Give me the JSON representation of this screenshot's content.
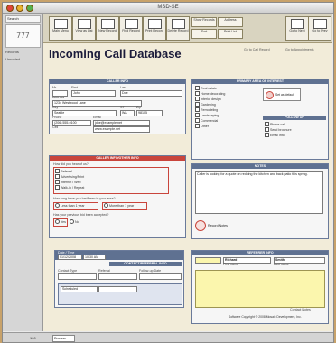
{
  "window": {
    "title": "MSD-SE",
    "light_colors": [
      "#e0443a",
      "#e8b230",
      "#55b14e"
    ]
  },
  "sidebar": {
    "search_label": "Search",
    "book_glyph": "777",
    "records_label": "Records",
    "unsorted_label": "Unsorted"
  },
  "toolbar": {
    "buttons": [
      {
        "label": "Main Menu",
        "icon": "home-icon"
      },
      {
        "label": "View as List",
        "icon": "list-view-icon"
      },
      {
        "label": "New Record",
        "icon": "new-record-icon"
      },
      {
        "label": "Find Record",
        "icon": "find-icon"
      },
      {
        "label": "Print Record",
        "icon": "print-icon"
      },
      {
        "label": "Delete Record",
        "icon": "delete-icon"
      }
    ],
    "small_buttons": [
      "Show Records",
      "Address",
      "Sort",
      "Print List"
    ],
    "right_buttons": [
      {
        "label": "Go to Next",
        "icon": "next-icon"
      },
      {
        "label": "Go to Prev",
        "icon": "previous-icon"
      }
    ]
  },
  "page": {
    "title": "Incoming Call Database",
    "links": [
      "Go to Call Record",
      "Go to Appointments"
    ]
  },
  "caller_info": {
    "header": "CALLER INFO",
    "labels": [
      "Mr.",
      "First",
      "Last",
      "Address",
      "Email",
      "City",
      "ST",
      "Zip",
      "Phone",
      "Cell"
    ],
    "first": "John",
    "last": "Doe",
    "address": "1234 Westwood Lane",
    "city": "Seattle",
    "state": "WA",
    "zip": "98105",
    "email": "jdoe@example.net",
    "bottom_fields": [
      "(206) 555-0100",
      "www.example.net"
    ]
  },
  "interest": {
    "header": "PRIMARY AREA OF INTEREST",
    "options": [
      "Real estate",
      "Home decorating",
      "Interior design",
      "Gardening",
      "Remodeling",
      "Landscaping",
      "Commercial",
      "Other"
    ],
    "button": "Set as default",
    "subheader": "FOLLOW UP",
    "followups": [
      "Phone call",
      "Send brochure",
      "Email info"
    ]
  },
  "call_info": {
    "header": "CALLER INFO/OTHER INFO",
    "found_label": "How did you hear of us?",
    "found_options": [
      "Referral",
      "Advertising/Print",
      "Internet / Web",
      "Walk-in / Repeat"
    ],
    "budget_label": "How long have you had/been in your area?",
    "budget_options": [
      "Less than 1 year",
      "More than 1 year"
    ],
    "repeat_label": "Has your previous bid been accepted?",
    "repeat_options": [
      "Yes",
      "No"
    ]
  },
  "notes": {
    "header": "NOTES",
    "text": "Caller is looking for a quote on redoing the kitchen and back patio this spring.",
    "icon_label": "Record Notes"
  },
  "contact_section": {
    "header": "CONTACT/REFERRAL INFO",
    "date_label": "Date / Time",
    "date_value": "01/12/2008",
    "time_value": "10:30 AM",
    "rows": [
      "Contact Type",
      "Referral",
      "Follow-up Date"
    ],
    "extra": "Scheduled"
  },
  "referrer": {
    "header": "REFERRER INFO",
    "first": "Richard",
    "last": "Smith",
    "first_label": "First name",
    "last_label": "Last name",
    "note_label": "Contact Notes"
  },
  "footer": {
    "copyright": "Software Copyright © 2008 Mosaic Development, Inc."
  },
  "status": {
    "zoom": "100",
    "mode": "Browse"
  }
}
